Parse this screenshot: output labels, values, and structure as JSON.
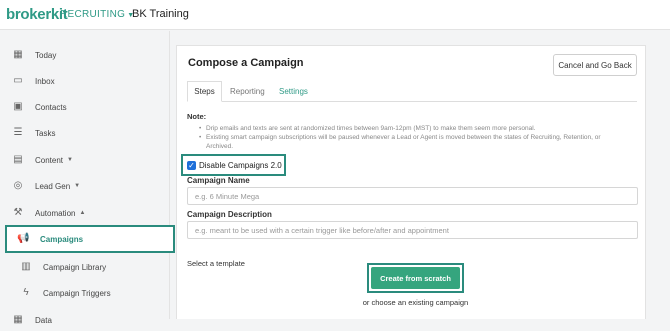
{
  "app": {
    "brand": "brokerkit",
    "module": "RECRUITING",
    "organization": "BK Training",
    "accent_color": "#2f9a86"
  },
  "sidebar": {
    "items": [
      {
        "label": "Today",
        "icon": "calendar-icon"
      },
      {
        "label": "Inbox",
        "icon": "inbox-icon"
      },
      {
        "label": "Contacts",
        "icon": "contacts-icon"
      },
      {
        "label": "Tasks",
        "icon": "tasks-icon"
      },
      {
        "label": "Content",
        "icon": "content-icon"
      },
      {
        "label": "Lead Gen",
        "icon": "lead-gen-icon"
      },
      {
        "label": "Automation",
        "icon": "automation-icon"
      },
      {
        "label": "Campaigns",
        "icon": "megaphone-icon"
      },
      {
        "label": "Campaign Library",
        "icon": "library-icon"
      },
      {
        "label": "Campaign Triggers",
        "icon": "trigger-icon"
      },
      {
        "label": "Data",
        "icon": "data-icon"
      }
    ],
    "active": "Campaigns"
  },
  "panel": {
    "title": "Compose a Campaign",
    "cancel_label": "Cancel and Go Back",
    "tabs": [
      "Steps",
      "Reporting",
      "Settings"
    ],
    "note_label": "Note:",
    "notes": [
      "Drip emails and texts are sent at randomized times between 9am-12pm (MST) to make them seem more personal.",
      "Existing smart campaign subscriptions will be paused whenever a Lead or Agent is moved between the states of Recruiting, Retention, or Archived."
    ],
    "checkbox_label": "Disable Campaigns 2.0",
    "checkbox_checked": true,
    "name_label": "Campaign Name",
    "name_placeholder": "e.g. 6 Minute Mega",
    "description_label": "Campaign Description",
    "description_placeholder": "e.g. meant to be used with a certain trigger like before/after and appointment",
    "select_template_label": "Select a template",
    "create_label": "Create from scratch",
    "or_label": "or choose an existing campaign"
  }
}
